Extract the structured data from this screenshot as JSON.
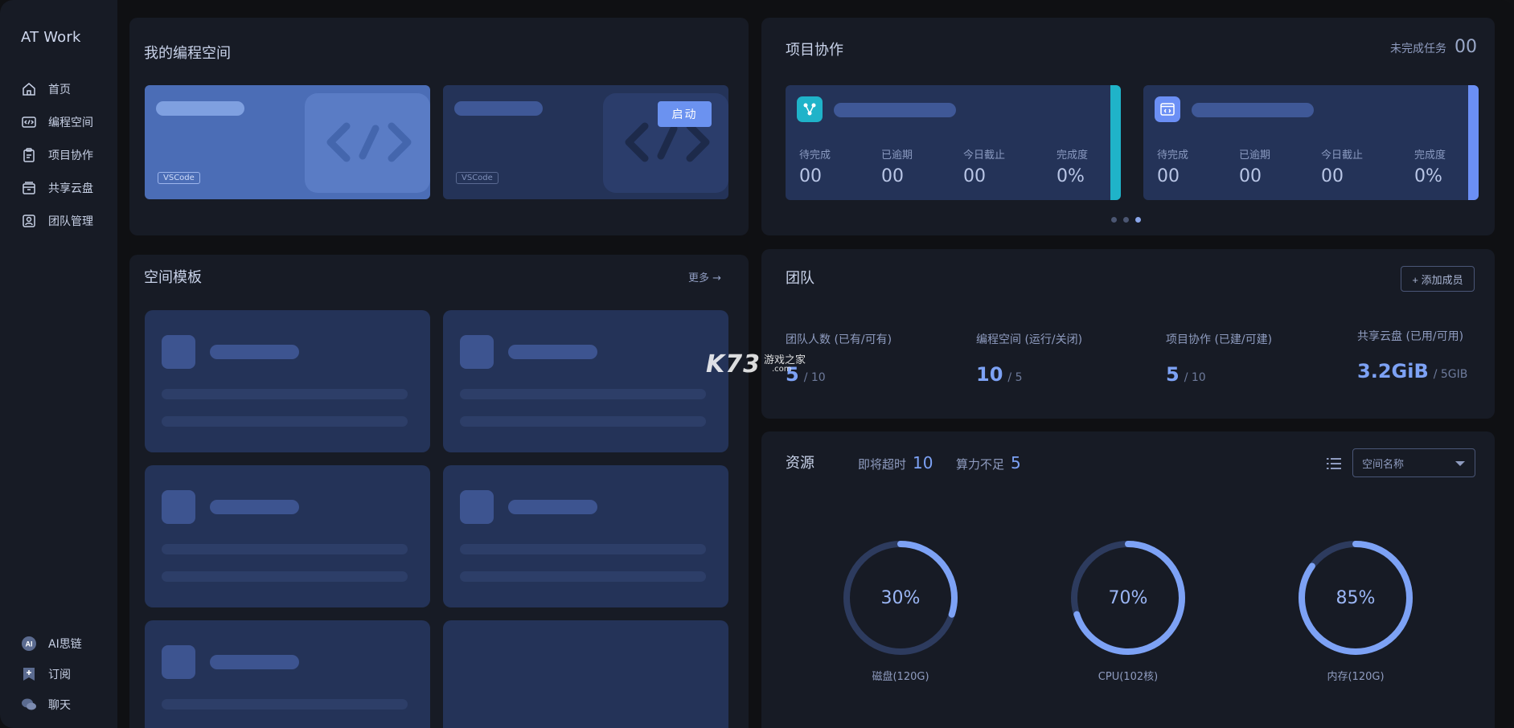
{
  "brand": "AT Work",
  "nav": {
    "items": [
      {
        "label": "首页",
        "icon": "home-icon"
      },
      {
        "label": "编程空间",
        "icon": "code-icon"
      },
      {
        "label": "项目协作",
        "icon": "clipboard-icon"
      },
      {
        "label": "共享云盘",
        "icon": "cloud-drive-icon"
      },
      {
        "label": "团队管理",
        "icon": "team-icon"
      }
    ],
    "bottom": [
      {
        "label": "AI思链",
        "icon": "ai-icon"
      },
      {
        "label": "订阅",
        "icon": "subscribe-icon"
      },
      {
        "label": "聊天",
        "icon": "chat-icon"
      }
    ]
  },
  "workspace": {
    "title": "我的编程空间",
    "cards": [
      {
        "tag": "VSCode"
      },
      {
        "tag": "VSCode",
        "button": "启动"
      }
    ]
  },
  "projects": {
    "title": "项目协作",
    "pending_label": "未完成任务",
    "pending_value": "00",
    "cards": [
      {
        "accent": "#1fb3c9",
        "stats": [
          {
            "label": "待完成",
            "value": "00"
          },
          {
            "label": "已逾期",
            "value": "00"
          },
          {
            "label": "今日截止",
            "value": "00"
          },
          {
            "label": "完成度",
            "value": "0%"
          }
        ]
      },
      {
        "accent": "#6b8ff5",
        "stats": [
          {
            "label": "待完成",
            "value": "00"
          },
          {
            "label": "已逾期",
            "value": "00"
          },
          {
            "label": "今日截止",
            "value": "00"
          },
          {
            "label": "完成度",
            "value": "0%"
          }
        ]
      }
    ],
    "carousel": {
      "count": 3,
      "active": 2
    }
  },
  "templates": {
    "title": "空间模板",
    "more": "更多 →"
  },
  "team": {
    "title": "团队",
    "add_button": "+ 添加成员",
    "stats": [
      {
        "label": "团队人数 (已有/可有)",
        "value": "5",
        "total": "/ 10"
      },
      {
        "label": "编程空间 (运行/关闭)",
        "value": "10",
        "total": "/ 5"
      },
      {
        "label": "项目协作 (已建/可建)",
        "value": "5",
        "total": "/ 10"
      },
      {
        "label": "共享云盘 (已用/可用)",
        "value": "3.2GiB",
        "total": "/ 5GIB"
      }
    ]
  },
  "resources": {
    "title": "资源",
    "timeout_label": "即将超时",
    "timeout_value": "10",
    "insufficient_label": "算力不足",
    "insufficient_value": "5",
    "select_placeholder": "空间名称",
    "gauges": [
      {
        "label": "磁盘(120G)",
        "percent": 30,
        "text": "30%"
      },
      {
        "label": "CPU(102核)",
        "percent": 70,
        "text": "70%"
      },
      {
        "label": "内存(120G)",
        "percent": 85,
        "text": "85%"
      }
    ]
  },
  "watermark": {
    "logo": "K73",
    "text": "游戏之家",
    "domain": ".com"
  },
  "colors": {
    "accent": "#6b92f0",
    "panel": "#171b25",
    "card": "#243358"
  }
}
